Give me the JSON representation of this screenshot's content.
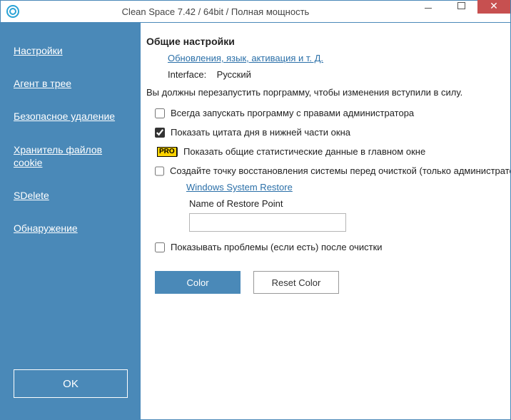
{
  "titlebar": {
    "title": "Clean Space 7.42 / 64bit / Полная мощность"
  },
  "sidebar": {
    "items": [
      {
        "label": "Настройки"
      },
      {
        "label": "Агент в трее"
      },
      {
        "label": "Безопасное удаление"
      },
      {
        "label": "Хранитель файлов cookie"
      },
      {
        "label": "SDelete"
      },
      {
        "label": "Обнаружение"
      }
    ],
    "ok_label": "OK"
  },
  "content": {
    "heading": "Общие настройки",
    "updates_link": "Обновления, язык, активация и т. Д.",
    "interface_label": "Interface:",
    "interface_value": "Русский",
    "restart_note": "Вы должны перезапустить порграмму, чтобы изменения вступили в силу.",
    "chk_admin": "Всегда запускать программу с правами администратора",
    "chk_quote": "Показать цитата дня в нижней части окна",
    "pro_badge": "PRO",
    "chk_stats": "Показать общие статистические данные в главном окне",
    "chk_restore": "Создайте точку восстановления системы перед очисткой (только администраторы)",
    "restore_link": "Windows System Restore",
    "restore_name_label": "Name of Restore Point",
    "restore_name_value": "",
    "chk_problems": "Показывать проблемы (если есть) после очистки",
    "color_btn": "Color",
    "reset_btn": "Reset Color"
  },
  "checkbox_state": {
    "admin": false,
    "quote": true,
    "stats": true,
    "restore": false,
    "problems": false
  }
}
